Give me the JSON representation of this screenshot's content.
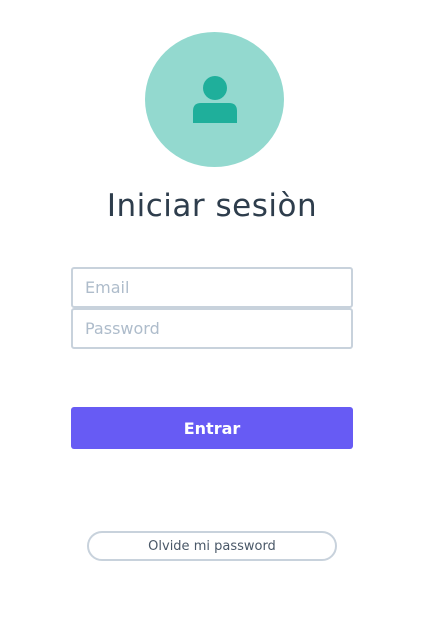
{
  "login": {
    "avatar_icon": "user-icon",
    "title": "Iniciar sesiòn",
    "email": {
      "placeholder": "Email",
      "value": ""
    },
    "password": {
      "placeholder": "Password",
      "value": ""
    },
    "submit_label": "Entrar",
    "forgot_label": "Olvide mi password"
  },
  "colors": {
    "avatar_bg": "#93d9cf",
    "avatar_icon": "#1faf9b",
    "title_text": "#2e3d4c",
    "field_border": "#c8d2dc",
    "placeholder": "#aebccb",
    "primary_button": "#675bf4",
    "primary_button_text": "#ffffff",
    "secondary_border": "#c8d2dc",
    "secondary_text": "#4a5868"
  }
}
